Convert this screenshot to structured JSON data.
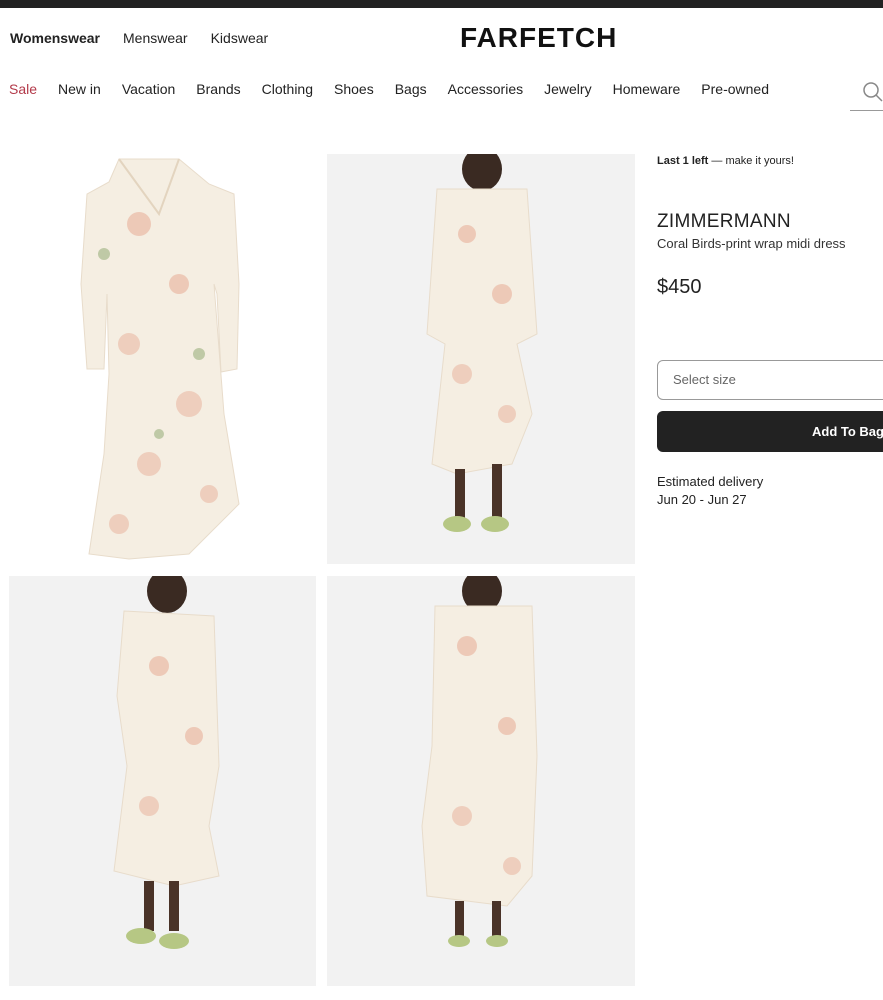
{
  "header": {
    "gender_nav": [
      "Womenswear",
      "Menswear",
      "Kidswear"
    ],
    "logo": "FARFETCH",
    "categories": [
      "Sale",
      "New in",
      "Vacation",
      "Brands",
      "Clothing",
      "Shoes",
      "Bags",
      "Accessories",
      "Jewelry",
      "Homeware",
      "Pre-owned"
    ],
    "search_icon": "search-icon"
  },
  "gallery": {
    "images": [
      "dress-flat-front",
      "model-front",
      "model-side",
      "model-back"
    ]
  },
  "product": {
    "stock_strong": "Last 1 left",
    "stock_rest": " — make it yours!",
    "brand": "ZIMMERMANN",
    "name": "Coral Birds-print wrap midi dress",
    "price": "$450",
    "size_placeholder": "Select size",
    "add_to_bag": "Add To Bag",
    "delivery_label": "Estimated delivery",
    "delivery_dates": "Jun 20 - Jun 27"
  },
  "colors": {
    "sale": "#b33a4a",
    "button": "#222222",
    "photo_bg": "#f2f2f2",
    "dress": "#f5eee2",
    "print": "#e9b7a4"
  }
}
